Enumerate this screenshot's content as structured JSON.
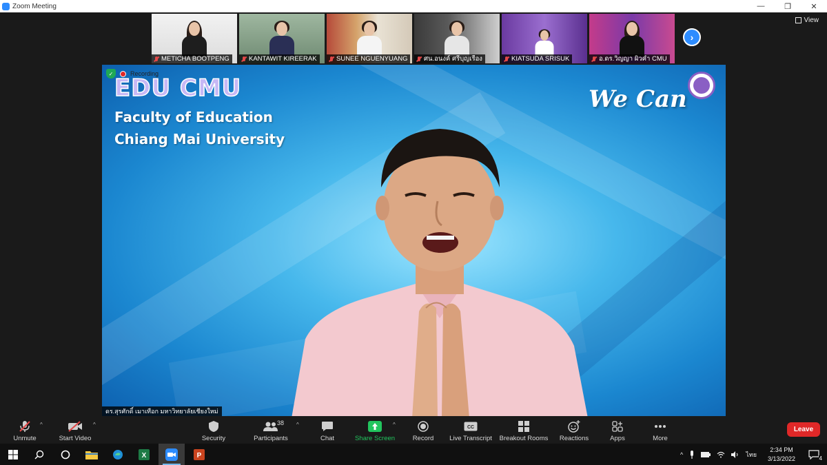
{
  "window": {
    "title": "Zoom Meeting"
  },
  "view_button": {
    "label": "View"
  },
  "thumbnails": [
    {
      "name": "METICHA BOOTPENG"
    },
    {
      "name": "KANTAWIT KIREERAK"
    },
    {
      "name": "SUNEE NGUENYUANG"
    },
    {
      "name": "ศน.อนงค์ ศรีบุญเรือง"
    },
    {
      "name": "KIATSUDA SRISUK"
    },
    {
      "name": "อ.ดร.วิญญา ผิวคำ CMU"
    }
  ],
  "main_video": {
    "recording_label": "Recording",
    "logo_text": "EDU CMU",
    "line1": "Faculty  of Education",
    "line2": "Chiang Mai University",
    "slogan": "We Can",
    "speaker_name": "ดร.สุรศักดิ์ เมาเทือก มหาวิทยาลัยเชียงใหม่"
  },
  "toolbar": {
    "unmute": "Unmute",
    "start_video": "Start Video",
    "security": "Security",
    "participants": "Participants",
    "participants_count": "38",
    "chat": "Chat",
    "share_screen": "Share Screen",
    "record": "Record",
    "live_transcript": "Live Transcript",
    "breakout_rooms": "Breakout Rooms",
    "reactions": "Reactions",
    "apps": "Apps",
    "more": "More",
    "leave": "Leave"
  },
  "taskbar": {
    "language": "ไทย",
    "time": "2:34 PM",
    "date": "3/13/2022",
    "notification_count": "4"
  },
  "colors": {
    "accent": "#2d8cff",
    "leave": "#e02828",
    "share": "#22c55e",
    "muted": "#e24848"
  }
}
